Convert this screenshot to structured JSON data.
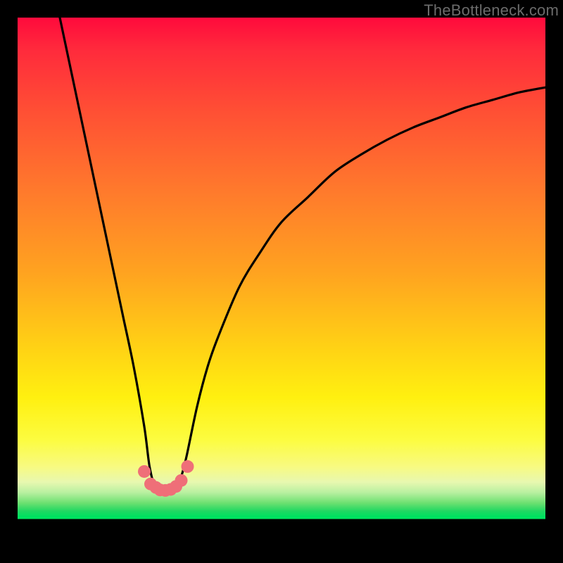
{
  "watermark": {
    "text": "TheBottleneck.com"
  },
  "chart_data": {
    "type": "line",
    "title": "",
    "xlabel": "",
    "ylabel": "",
    "xlim": [
      0,
      100
    ],
    "ylim": [
      0,
      100
    ],
    "grid": false,
    "legend": false,
    "annotations": [],
    "series": [
      {
        "name": "bottleneck-curve",
        "color": "#000000",
        "x": [
          8,
          10,
          12,
          14,
          16,
          18,
          20,
          22,
          24,
          25,
          26,
          27,
          28,
          29,
          30,
          31,
          32,
          34,
          36,
          38,
          42,
          46,
          50,
          55,
          60,
          65,
          70,
          75,
          80,
          85,
          90,
          95,
          100
        ],
        "values": [
          100,
          90,
          80,
          70,
          60,
          50,
          40,
          30,
          18,
          10,
          6,
          5,
          5,
          5,
          6,
          8,
          12,
          22,
          30,
          36,
          46,
          53,
          59,
          64,
          69,
          72.5,
          75.5,
          78,
          80,
          82,
          83.5,
          85,
          86
        ]
      }
    ],
    "markers": {
      "name": "valley-dots",
      "color": "#ef6f78",
      "radius_px": 9,
      "x": [
        24.0,
        25.2,
        26.2,
        27.0,
        28.0,
        29.0,
        30.0,
        31.0,
        32.2
      ],
      "values": [
        9.0,
        6.5,
        5.8,
        5.3,
        5.2,
        5.4,
        6.0,
        7.2,
        10.0
      ]
    }
  }
}
